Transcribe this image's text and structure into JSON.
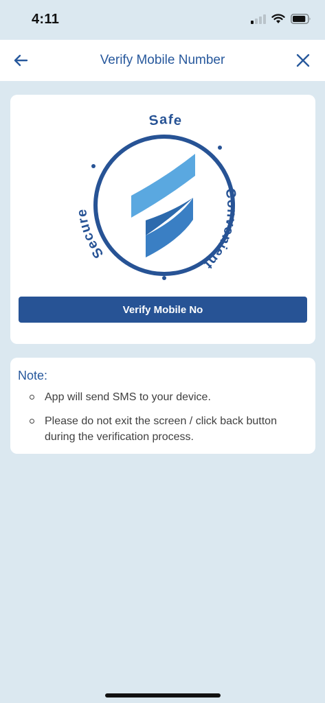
{
  "status_bar": {
    "time": "4:11",
    "signal_bars_on": 1,
    "signal_bars_total": 4,
    "wifi_icon": "wifi-icon",
    "battery_icon": "battery-icon",
    "battery_level": 0.85
  },
  "header": {
    "title": "Verify Mobile Number",
    "back_icon": "arrow-left-icon",
    "close_icon": "close-icon"
  },
  "hero": {
    "logo_words": [
      "Safe",
      "Convenient",
      "Secure"
    ],
    "button_label": "Verify Mobile No"
  },
  "note": {
    "title": "Note:",
    "items": [
      "App will send SMS to your device.",
      "Please do not exit the screen / click back button during the verification process."
    ]
  },
  "colors": {
    "background": "#dbe8f0",
    "primary": "#275395",
    "accent_light": "#5aa8e0",
    "accent_dark": "#3a7fc4",
    "card": "#ffffff"
  }
}
